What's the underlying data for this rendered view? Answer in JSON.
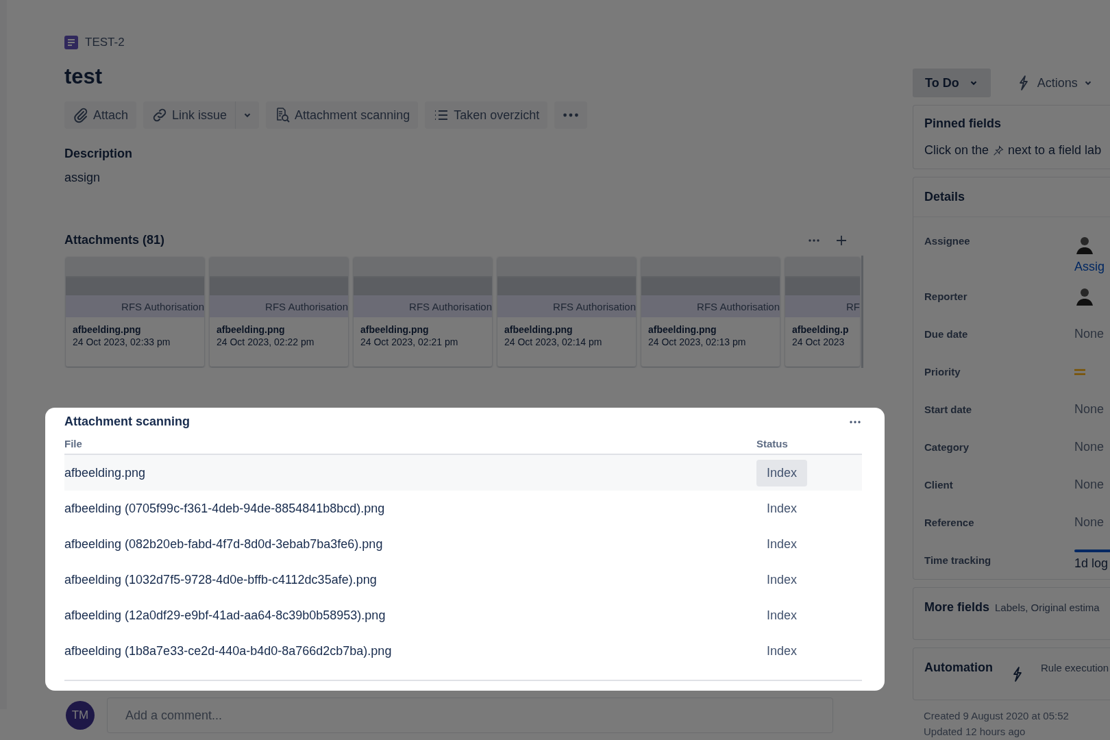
{
  "issue": {
    "key": "TEST-2",
    "title": "test"
  },
  "toolbar": [
    {
      "kind": "attach",
      "label": "Attach"
    },
    {
      "kind": "link",
      "label": "Link issue"
    },
    {
      "kind": "caret"
    },
    {
      "kind": "scan",
      "label": "Attachment scanning"
    },
    {
      "kind": "list",
      "label": "Taken overzicht"
    },
    {
      "kind": "more"
    }
  ],
  "description": {
    "heading": "Description",
    "text": "assign"
  },
  "attachments": {
    "heading": "Attachments (81)",
    "cards": [
      {
        "banner": "RFS Authorisation",
        "name": "afbeelding.png",
        "date": "24 Oct 2023, 02:33 pm"
      },
      {
        "banner": "RFS Authorisation",
        "name": "afbeelding.png",
        "date": "24 Oct 2023, 02:22 pm"
      },
      {
        "banner": "RFS Authorisation",
        "name": "afbeelding.png",
        "date": "24 Oct 2023, 02:21 pm"
      },
      {
        "banner": "RFS Authorisation",
        "name": "afbeelding.png",
        "date": "24 Oct 2023, 02:14 pm"
      },
      {
        "banner": "RFS Authorisation",
        "name": "afbeelding.png",
        "date": "24 Oct 2023, 02:13 pm"
      },
      {
        "banner": "RF",
        "name": "afbeelding.p",
        "date": "24 Oct 2023"
      }
    ]
  },
  "dialog": {
    "title": "Attachment scanning",
    "columns": [
      "File",
      "Status"
    ],
    "rows": [
      {
        "file": "afbeelding.png",
        "status": "Index",
        "selected": true
      },
      {
        "file": "afbeelding (0705f99c-f361-4deb-94de-8854841b8bcd).png",
        "status": "Index",
        "selected": false
      },
      {
        "file": "afbeelding (082b20eb-fabd-4f7d-8d0d-3ebab7ba3fe6).png",
        "status": "Index",
        "selected": false
      },
      {
        "file": "afbeelding (1032d7f5-9728-4d0e-bffb-c4112dc35afe).png",
        "status": "Index",
        "selected": false
      },
      {
        "file": "afbeelding (12a0df29-e9bf-41ad-aa64-8c39b0b58953).png",
        "status": "Index",
        "selected": false
      },
      {
        "file": "afbeelding (1b8a7e33-ce2d-440a-b4d0-8a766d2cb7ba).png",
        "status": "Index",
        "selected": false
      }
    ]
  },
  "comment": {
    "avatar": "TM",
    "placeholder": "Add a comment..."
  },
  "status_button": "To Do",
  "actions_button": "Actions",
  "pinned": {
    "heading": "Pinned fields",
    "text_before": "Click on the",
    "text_after": "next to a field lab"
  },
  "details": {
    "heading": "Details",
    "fields": [
      {
        "label": "Assignee",
        "kind": "person",
        "link": "Assig"
      },
      {
        "label": "Reporter",
        "kind": "person"
      },
      {
        "label": "Due date",
        "kind": "text",
        "value": "None"
      },
      {
        "label": "Priority",
        "kind": "priority"
      },
      {
        "label": "Start date",
        "kind": "text",
        "value": "None"
      },
      {
        "label": "Category",
        "kind": "text",
        "value": "None"
      },
      {
        "label": "Client",
        "kind": "text",
        "value": "None"
      },
      {
        "label": "Reference",
        "kind": "text",
        "value": "None"
      },
      {
        "label": "Time tracking",
        "kind": "tracking",
        "value": "1d log"
      }
    ]
  },
  "more_fields": {
    "heading": "More fields",
    "text": "Labels, Original estima"
  },
  "automation": {
    "heading": "Automation",
    "text": "Rule execution"
  },
  "footer": [
    "Created 9 August 2020 at 05:52",
    "Updated 12 hours ago"
  ]
}
